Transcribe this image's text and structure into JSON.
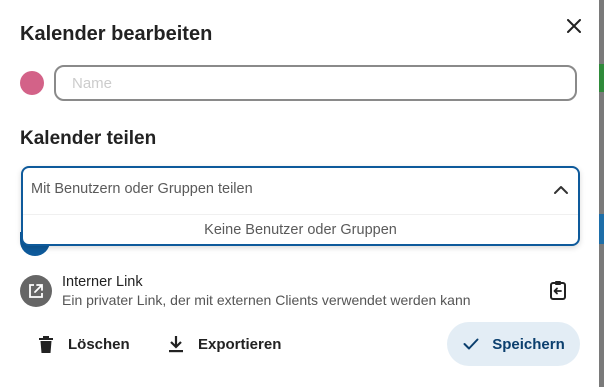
{
  "dialog": {
    "title": "Kalender bearbeiten",
    "calendar_color": "#d36288",
    "calendar_name_value": "",
    "calendar_name_placeholder": "Name"
  },
  "share": {
    "section_title": "Kalender teilen",
    "search_placeholder": "Mit Benutzern oder Gruppen teilen",
    "empty_text": "Keine Benutzer oder Gruppen"
  },
  "internal_link": {
    "title": "Interner Link",
    "subtitle": "Ein privater Link, der mit externen Clients verwendet werden kann"
  },
  "footer": {
    "delete_label": "Löschen",
    "export_label": "Exportieren",
    "save_label": "Speichern"
  },
  "icons": {
    "close": "close-icon",
    "chevron": "chevron-up-icon",
    "external_link": "external-link-icon",
    "copy": "clipboard-copy-icon",
    "delete": "trash-icon",
    "export": "download-icon",
    "save": "check-icon"
  },
  "colors": {
    "accent": "#0e5a9b",
    "save_bg": "#e3edf5",
    "save_text": "#0b3f6e"
  }
}
